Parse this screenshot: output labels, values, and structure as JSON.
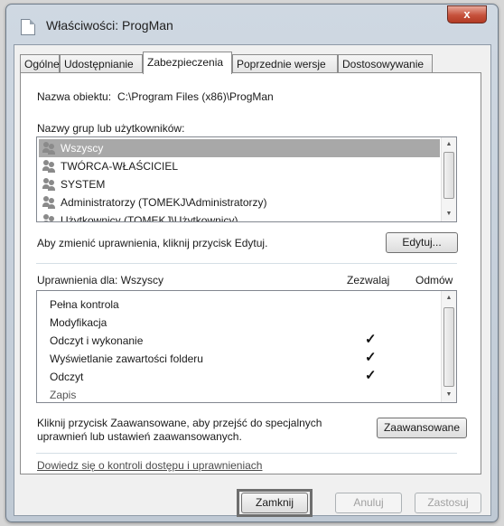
{
  "window": {
    "title": "Właściwości: ProgMan",
    "close_label": "x"
  },
  "tabs": [
    {
      "label": "Ogólne",
      "active": false
    },
    {
      "label": "Udostępnianie",
      "active": false
    },
    {
      "label": "Zabezpieczenia",
      "active": true
    },
    {
      "label": "Poprzednie wersje",
      "active": false
    },
    {
      "label": "Dostosowywanie",
      "active": false
    }
  ],
  "object": {
    "label": "Nazwa obiektu:",
    "path": "C:\\Program Files (x86)\\ProgMan"
  },
  "users": {
    "label": "Nazwy grup lub użytkowników:",
    "items": [
      {
        "name": "Wszyscy",
        "selected": true
      },
      {
        "name": "TWÓRCA-WŁAŚCICIEL",
        "selected": false
      },
      {
        "name": "SYSTEM",
        "selected": false
      },
      {
        "name": "Administratorzy (TOMEKJ\\Administratorzy)",
        "selected": false
      },
      {
        "name": "Użytkownicy (TOMEKJ\\Użytkownicy)",
        "selected": false
      }
    ]
  },
  "edit": {
    "hint": "Aby zmienić uprawnienia, kliknij przycisk Edytuj.",
    "button": "Edytuj..."
  },
  "permissions": {
    "label": "Uprawnienia dla: Wszyscy",
    "allow_header": "Zezwalaj",
    "deny_header": "Odmów",
    "check_glyph": "✓",
    "rows": [
      {
        "name": "Pełna kontrola",
        "allow": false,
        "deny": false
      },
      {
        "name": "Modyfikacja",
        "allow": false,
        "deny": false
      },
      {
        "name": "Odczyt i wykonanie",
        "allow": true,
        "deny": false
      },
      {
        "name": "Wyświetlanie zawartości folderu",
        "allow": true,
        "deny": false
      },
      {
        "name": "Odczyt",
        "allow": true,
        "deny": false
      },
      {
        "name": "Zapis",
        "allow": false,
        "deny": false
      }
    ]
  },
  "advanced": {
    "hint_line1": "Kliknij przycisk Zaawansowane, aby przejść do specjalnych",
    "hint_line2": "uprawnień lub ustawień zaawansowanych.",
    "button": "Zaawansowane"
  },
  "help_link": "Dowiedz się o kontroli dostępu i uprawnieniach",
  "footer": {
    "close": "Zamknij",
    "cancel": "Anuluj",
    "apply": "Zastosuj"
  }
}
